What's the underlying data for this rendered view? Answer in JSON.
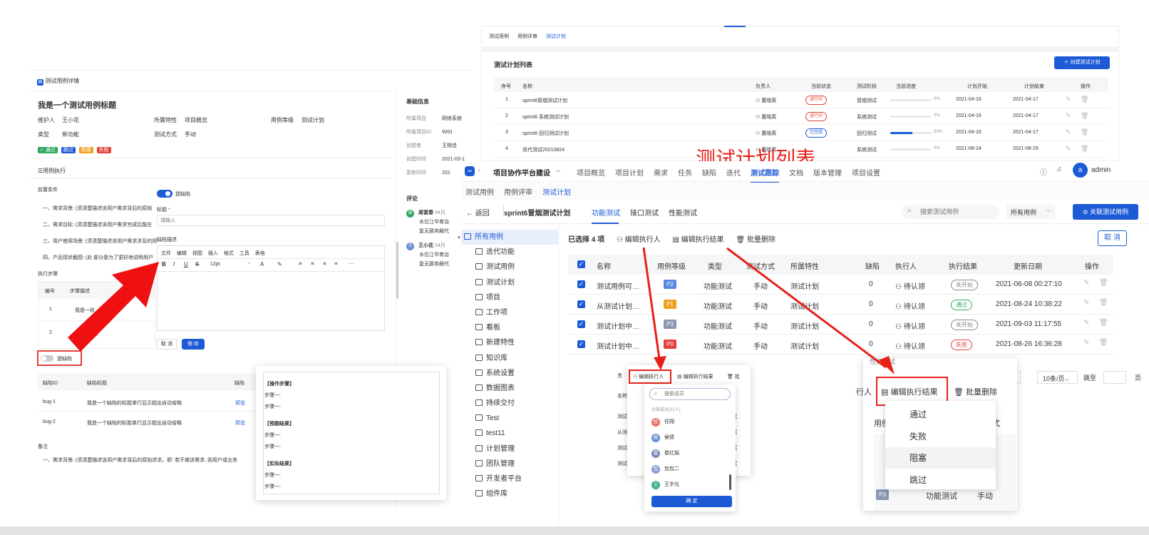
{
  "left_win": {
    "title": "测试用例详情",
    "case_title": "我是一个测试用例标题",
    "meta": [
      {
        "k": "维护人",
        "v": "王小花"
      },
      {
        "k": "所属特性",
        "v": "项目概览"
      },
      {
        "k": "用例等级",
        "v": "测试计划"
      },
      {
        "k": "类型",
        "v": "新功能"
      },
      {
        "k": "测试方式",
        "v": "手动"
      }
    ],
    "result_buttons": [
      "✓ 通过",
      "跳过",
      "阻塞",
      "失败"
    ],
    "section_exec": "☰用例执行",
    "pre_label": "前置条件",
    "pre_items": [
      "一、需求背景: (须清楚描述该用户需求背后的原始",
      "二、需求目标: (须清楚描述该用户需求完成后能在",
      "三、用户使用场景: (须清楚描述该用户需求涉及的用",
      "四、产品现状截图: (此 部分是为了更好地说明用户"
    ],
    "steps_label": "执行步骤",
    "steps_headers": [
      "编号",
      "步骤描述"
    ],
    "steps_rows": [
      {
        "no": "1",
        "desc": "我是一段"
      },
      {
        "no": "2",
        "desc": "描述"
      }
    ],
    "bug_toggle_label": "提缺陷",
    "bug_headers": [
      "缺陷ID",
      "缺陷标题",
      "缺陷"
    ],
    "bug_rows": [
      {
        "id": "bug-1",
        "title": "我是一个缺陷的标题单行显示超出自动省略",
        "link": "预览"
      },
      {
        "id": "bug-2",
        "title": "我是一个缺陷的标题单行显示超出自动省略",
        "link": "预览"
      }
    ],
    "remark_label": "备注",
    "remark_text": "一、需求背景: (须清楚描述该用户需求背后的原始述求。即: 若不做该需求, 则用户或业务",
    "bug_form": {
      "toggle_label": "提缺陷",
      "title_label": "标题",
      "title_placeholder": "请输入",
      "desc_label": "缺陷描述",
      "menus": [
        "文件",
        "编辑",
        "视图",
        "插入",
        "格式",
        "工具",
        "表格"
      ],
      "font_size": "12pt",
      "cancel": "取 消",
      "save": "保 存"
    },
    "basic_label": "基础信息",
    "basic": [
      {
        "k": "所属项目",
        "v": "网络系统"
      },
      {
        "k": "所属项目ID",
        "v": "IMSI"
      },
      {
        "k": "创建者",
        "v": "王晓佳"
      },
      {
        "k": "创建时间",
        "v": "2021-03-1"
      },
      {
        "k": "更新时间",
        "v": "202"
      }
    ],
    "comment_label": "评论",
    "comments": [
      {
        "avatar": "周",
        "name": "周富春",
        "time": "04月",
        "text1": "水位江华育治",
        "text2": "复无那务解代"
      },
      {
        "avatar": "王",
        "name": "王小花",
        "time": "04月",
        "text1": "水位江华育治",
        "text2": "复无那务解代"
      }
    ]
  },
  "steps_popup": {
    "groups": [
      {
        "title": "【操作步骤】",
        "items": [
          "步骤一:",
          "步骤一:"
        ]
      },
      {
        "title": "【预期结果】",
        "items": [
          "步骤一:",
          "步骤一:"
        ]
      },
      {
        "title": "【实际结果】",
        "items": [
          "步骤一:",
          "步骤一:"
        ]
      }
    ]
  },
  "top_win": {
    "tabs": [
      "测试用例",
      "用例评审",
      "测试计划"
    ],
    "list_title": "测试计划列表",
    "create_btn": "＋ 创建测试计划",
    "headers": [
      "序号",
      "名称",
      "负责人",
      "当前状态",
      "测试阶段",
      "当前进度",
      "计划开始",
      "计划结束",
      "操作"
    ],
    "rows": [
      {
        "no": "1",
        "name": "sprint6冒烟测试计划",
        "owner": "惠晓英",
        "status": "进行中",
        "stage": "冒烟测试",
        "progress": 0,
        "pct": "0%",
        "start": "2021-04-16",
        "end": "2021-04-17"
      },
      {
        "no": "2",
        "name": "sprint6 系统测试计划",
        "owner": "惠晓英",
        "status": "进行中",
        "stage": "系统测试",
        "progress": 0,
        "pct": "0%",
        "start": "2021-04-16",
        "end": "2021-04-17"
      },
      {
        "no": "3",
        "name": "sprint6 回归测试计划",
        "owner": "惠晓英",
        "status": "已完成",
        "stage": "回归测试",
        "progress": 53,
        "pct": "53%",
        "start": "2021-04-16",
        "end": "2021-04-17"
      },
      {
        "no": "4",
        "name": "迭代测试20210824",
        "owner": "惠晓英",
        "status": "",
        "stage": "系统测试",
        "progress": 0,
        "pct": "0%",
        "start": "2021-08-24",
        "end": "2021-08-29"
      }
    ]
  },
  "overlay_title": "测试计划列表",
  "main_win": {
    "project": "项目协作平台建设",
    "nav": [
      "项目概览",
      "项目计划",
      "需求",
      "任务",
      "缺陷",
      "迭代",
      "测试跟踪",
      "文档",
      "版本管理",
      "项目设置"
    ],
    "nav_active": "测试跟踪",
    "user": "admin",
    "user_avatar": "a",
    "sub_tabs": [
      "测试用例",
      "用例评审",
      "测试计划"
    ],
    "back": "返回",
    "plan_name": "sprint6冒烟测试计划",
    "type_tabs": [
      "功能测试",
      "接口测试",
      "性能测试"
    ],
    "search_placeholder": "搜索测试用例",
    "filter": "所有用例",
    "link_btn": "⊘ 关联测试用例",
    "tree": [
      "所有用例",
      "迭代功能",
      "测试用例",
      "测试计划",
      "项目",
      "工作项",
      "看板",
      "新建特性",
      "知识库",
      "系统设置",
      "数据图表",
      "持续交付",
      "Test",
      "test11",
      "计划管理",
      "团队管理",
      "开发者平台",
      "组件库"
    ],
    "selected": "已选择 4 项",
    "bulk": [
      "编辑执行人",
      "编辑执行结果",
      "批量删除"
    ],
    "cancel": "取 消",
    "headers": [
      "名称",
      "用例等级",
      "类型",
      "测试方式",
      "所属特性",
      "缺陷",
      "执行人",
      "执行结果",
      "更新日期",
      "操作"
    ],
    "rows": [
      {
        "name": "测试用例可…",
        "level": "P2",
        "type": "功能测试",
        "mode": "手动",
        "feature": "测试计划",
        "bugs": "0",
        "exec": "待认领",
        "result": "未开始",
        "date": "2021-06-08 00:27:10"
      },
      {
        "name": "从测试计划…",
        "level": "P1",
        "type": "功能测试",
        "mode": "手动",
        "feature": "测试计划",
        "bugs": "0",
        "exec": "待认领",
        "result": "通过",
        "date": "2021-08-24 10:38:22"
      },
      {
        "name": "测试计划中…",
        "level": "P3",
        "type": "功能测试",
        "mode": "手动",
        "feature": "测试计划",
        "bugs": "0",
        "exec": "待认领",
        "result": "未开始",
        "date": "2021-09-03 11:17:55"
      },
      {
        "name": "测试计划中…",
        "level": "P0",
        "type": "功能测试",
        "mode": "手动",
        "feature": "测试计划",
        "bugs": "0",
        "exec": "待认领",
        "result": "失败",
        "date": "2021-08-26 16:36:28"
      }
    ],
    "pager_size": "10条/页",
    "jump": "跳至",
    "page_unit": "页"
  },
  "assignee_popup": {
    "bar": [
      "编辑执行人",
      "编辑执行结果",
      "批"
    ],
    "search_placeholder": "搜索成员",
    "group": "全部成员(21人)",
    "members": [
      {
        "a": "任",
        "n": "任翔",
        "c": "#e8716b"
      },
      {
        "a": "侯",
        "n": "侯倩",
        "c": "#6b8dd6"
      },
      {
        "a": "崔",
        "n": "崔红娟",
        "c": "#7a8bb3"
      },
      {
        "a": "包",
        "n": "包包二",
        "c": "#8b9bd6"
      },
      {
        "a": "王",
        "n": "王宇光",
        "c": "#3fae86"
      }
    ],
    "ok": "确 定",
    "peek_name": "名称",
    "peek_rows": [
      "测试",
      "从测",
      "测试",
      "测试"
    ],
    "peek_b": "责",
    "peek_right": [
      "试",
      "试",
      "试",
      "试"
    ]
  },
  "result_popup": {
    "top_text": "性能测试",
    "left_cut": "行人",
    "edit": "编辑执行结果",
    "del": "批量删除",
    "options": [
      "通过",
      "失败",
      "阻塞",
      "跳过"
    ],
    "peek_head": [
      "用例",
      "方式"
    ],
    "peek_level": "P3",
    "peek_type": "功能测试",
    "peek_mode": [
      "手动",
      "手动",
      "手动"
    ]
  }
}
